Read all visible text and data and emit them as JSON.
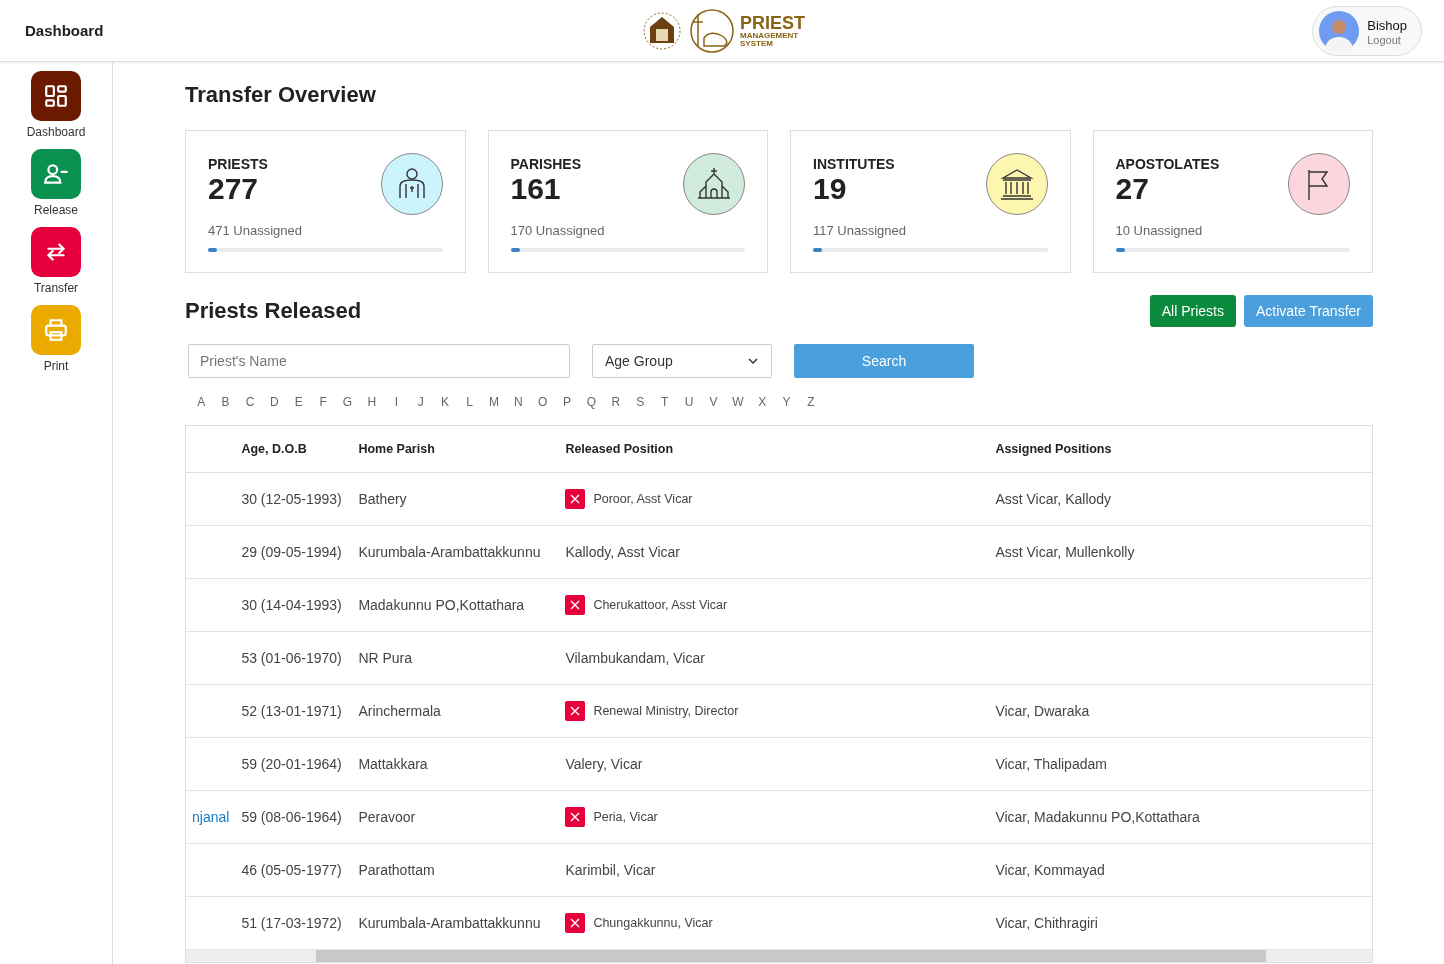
{
  "header": {
    "title": "Dashboard",
    "logo": {
      "line1": "PRIEST",
      "line2": "MANAGEMENT",
      "line3": "SYSTEM"
    },
    "user": {
      "name": "Bishop",
      "action": "Logout"
    }
  },
  "sidebar": {
    "items": [
      {
        "label": "Dashboard",
        "color": "#6b1a00"
      },
      {
        "label": "Release",
        "color": "#0a9150"
      },
      {
        "label": "Transfer",
        "color": "#e8003d"
      },
      {
        "label": "Print",
        "color": "#eaaa00"
      }
    ]
  },
  "page_title": "Transfer Overview",
  "stats": [
    {
      "label": "PRIESTS",
      "value": "277",
      "sub": "471 Unassigned",
      "level": 0.04,
      "color": "#cdf3fd"
    },
    {
      "label": "PARISHES",
      "value": "161",
      "sub": "170 Unassigned",
      "level": 0.04,
      "color": "#d0eadb"
    },
    {
      "label": "INSTITUTES",
      "value": "19",
      "sub": "117 Unassigned",
      "level": 0.04,
      "color": "#fdf6b0"
    },
    {
      "label": "APOSTOLATES",
      "value": "27",
      "sub": "10 Unassigned",
      "level": 0.04,
      "color": "#fbd6dd"
    }
  ],
  "section_title": "Priests Released",
  "actions": [
    {
      "label": "All Priests",
      "kind": "success"
    },
    {
      "label": "Activate Transfer",
      "kind": "info"
    }
  ],
  "filters": {
    "name_placeholder": "Priest's Name",
    "age_group": "Age Group",
    "search": "Search"
  },
  "alphabet": [
    "A",
    "B",
    "C",
    "D",
    "E",
    "F",
    "G",
    "H",
    "I",
    "J",
    "K",
    "L",
    "M",
    "N",
    "O",
    "P",
    "Q",
    "R",
    "S",
    "T",
    "U",
    "V",
    "W",
    "X",
    "Y",
    "Z"
  ],
  "table": {
    "columns": [
      "Age, D.O.B",
      "Home Parish",
      "Released Position",
      "Assigned Positions"
    ],
    "rows": [
      {
        "age": "30 (12-05-1993)",
        "parish": "Bathery",
        "released": "Poroor, Asst Vicar",
        "removable": true,
        "assigned": "Asst Vicar, Kallody"
      },
      {
        "age": "29 (09-05-1994)",
        "parish": "Kurumbala-Arambattakkunnu",
        "released": "Kallody, Asst Vicar",
        "removable": false,
        "assigned": "Asst Vicar, Mullenkolly"
      },
      {
        "age": "30 (14-04-1993)",
        "parish": "Madakunnu PO,Kottathara",
        "released": "Cherukattoor, Asst Vicar",
        "removable": true
      },
      {
        "age": "53 (01-06-1970)",
        "parish": "NR Pura",
        "released": "Vilambukandam, Vicar",
        "removable": false
      },
      {
        "age": "52 (13-01-1971)",
        "parish": "Arinchermala",
        "released": "Renewal Ministry, Director",
        "removable": true,
        "assigned": "Vicar, Dwaraka"
      },
      {
        "age": "59 (20-01-1964)",
        "parish": "Mattakkara",
        "released": "Valery, Vicar",
        "removable": false,
        "assigned": "Vicar, Thalipadam"
      },
      {
        "name": "njanal",
        "age": "59 (08-06-1964)",
        "parish": "Peravoor",
        "released": "Peria, Vicar",
        "removable": true,
        "assigned": "Vicar, Madakunnu PO,Kottathara"
      },
      {
        "age": "46 (05-05-1977)",
        "parish": "Parathottam",
        "released": "Karimbil, Vicar",
        "removable": false,
        "assigned": "Vicar, Kommayad"
      },
      {
        "age": "51 (17-03-1972)",
        "parish": "Kurumbala-Arambattakkunnu",
        "released": "Chungakkunnu, Vicar",
        "removable": true,
        "assigned": "Vicar, Chithragiri"
      }
    ]
  }
}
